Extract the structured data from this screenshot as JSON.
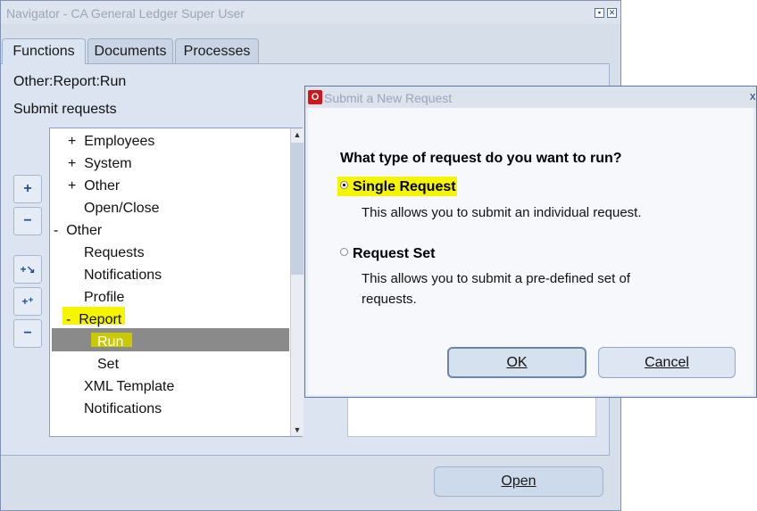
{
  "navigator": {
    "title": "Navigator - CA General Ledger Super User",
    "window_controls": [
      "▪",
      "✕"
    ],
    "tabs": [
      {
        "label": "Functions",
        "active": true
      },
      {
        "label": "Documents",
        "active": false
      },
      {
        "label": "Processes",
        "active": false
      }
    ],
    "path": "Other:Report:Run",
    "description": "Submit requests",
    "tree": [
      {
        "prefix": "+",
        "label": "Employees"
      },
      {
        "prefix": "+",
        "label": "System"
      },
      {
        "prefix": "+",
        "label": "Other"
      },
      {
        "prefix": "",
        "label": "Open/Close"
      },
      {
        "prefix": "-",
        "label": "Other"
      },
      {
        "prefix": "",
        "label": "Requests"
      },
      {
        "prefix": "",
        "label": "Notifications"
      },
      {
        "prefix": "",
        "label": "Profile"
      },
      {
        "prefix": "-",
        "label": "Report"
      },
      {
        "prefix": "",
        "label": "Run",
        "selected": true
      },
      {
        "prefix": "",
        "label": "Set"
      },
      {
        "prefix": "",
        "label": "XML Template"
      },
      {
        "prefix": "",
        "label": "Notifications"
      }
    ],
    "side_buttons": [
      "+",
      "−",
      "+↘",
      "+⁺",
      "−"
    ],
    "open_label": "Open"
  },
  "dialog": {
    "title": "Submit a New Request",
    "close_glyph": "x",
    "question": "What type of request do you want to run?",
    "options": [
      {
        "label": "Single Request",
        "description": "This allows you to submit an individual request.",
        "selected": true
      },
      {
        "label": "Request Set",
        "description_lines": [
          "This allows you to submit a pre-defined set of",
          "requests."
        ],
        "selected": false
      }
    ],
    "ok_label": "OK",
    "cancel_label": "Cancel"
  },
  "colors": {
    "window_bg": "#d6deea",
    "selection_bg": "#8a8a8a",
    "highlight": "#f5f500",
    "oracle_red": "#d0161d"
  }
}
